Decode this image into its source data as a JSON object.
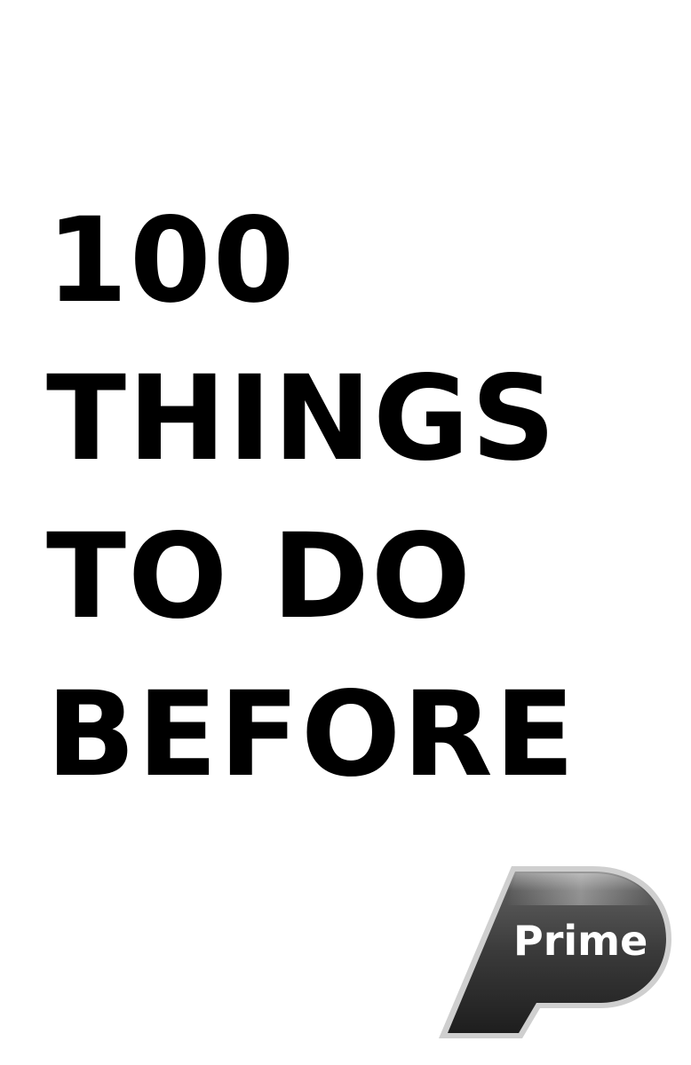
{
  "title": {
    "lines": [
      "100",
      "THINGS",
      "TO DO",
      "BEFORE"
    ]
  },
  "logo": {
    "text": "Prime",
    "colors": {
      "dark": "#2a2a2a",
      "mid": "#4a4a4a",
      "highlight": "#d9d9d9",
      "text": "#ffffff"
    }
  }
}
